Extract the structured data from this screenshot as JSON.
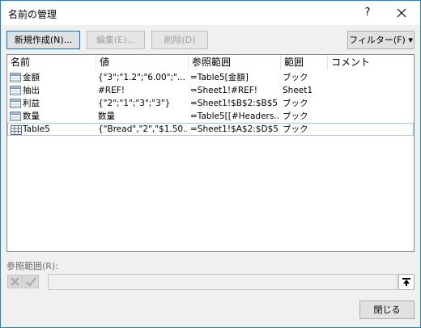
{
  "window": {
    "title": "名前の管理",
    "help_label": "?"
  },
  "toolbar": {
    "new_label": "新規作成(N)...",
    "edit_label": "編集(E)...",
    "delete_label": "削除(D)",
    "filter_label": "フィルター(F) ▾"
  },
  "table": {
    "columns": [
      "名前",
      "値",
      "参照範囲",
      "範囲",
      "コメント"
    ],
    "rows": [
      {
        "name": "金額",
        "value": "{\"3\";\"1.2\";\"6.00\";\"...",
        "ref": "=Table5[金額]",
        "scope": "ブック",
        "comment": "",
        "icon": "named-range-icon"
      },
      {
        "name": "抽出",
        "value": "#REF!",
        "ref": "=Sheet1!#REF!",
        "scope": "Sheet1",
        "comment": "",
        "icon": "named-range-icon"
      },
      {
        "name": "利益",
        "value": "{\"2\";\"1\";\"3\";\"3\"}",
        "ref": "=Sheet1!$B$2:$B$5",
        "scope": "ブック",
        "comment": "",
        "icon": "named-range-icon"
      },
      {
        "name": "数量",
        "value": "数量",
        "ref": "=Table5[[#Headers...",
        "scope": "ブック",
        "comment": "",
        "icon": "named-range-icon"
      },
      {
        "name": "Table5",
        "value": "{\"Bread\",\"2\",\"$1.50...",
        "ref": "=Sheet1!$A$2:$D$5",
        "scope": "ブック",
        "comment": "",
        "icon": "table-icon"
      }
    ]
  },
  "refers_to": {
    "label": "参照範囲(R):",
    "value": ""
  },
  "footer": {
    "close_label": "閉じる"
  }
}
